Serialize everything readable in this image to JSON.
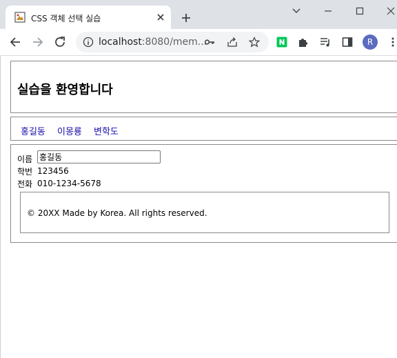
{
  "browser": {
    "tab": {
      "title": "CSS 객체 선택 실습",
      "favicon": "page-favicon-icon"
    },
    "address": {
      "host": "localhost",
      "rest": ":8080/mem..."
    },
    "profile_initial": "R",
    "colors": {
      "tabstrip": "#dee1e6",
      "omnibox": "#f1f3f4",
      "profile": "#5b6bc0",
      "naver": "#03c75a"
    }
  },
  "page": {
    "header": {
      "title": "실습을 환영합니다"
    },
    "nav": {
      "links": [
        "홍길동",
        "이몽룡",
        "변학도"
      ]
    },
    "form": {
      "name_label": "이름",
      "name_value": "홍길동",
      "id_label": "학번",
      "id_value": "123456",
      "phone_label": "전화",
      "phone_value": "010-1234-5678"
    },
    "footer": {
      "text": "© 20XX Made by Korea. All rights reserved."
    },
    "colors": {
      "link": "#1a0dab",
      "border": "#8a8a8a"
    }
  }
}
